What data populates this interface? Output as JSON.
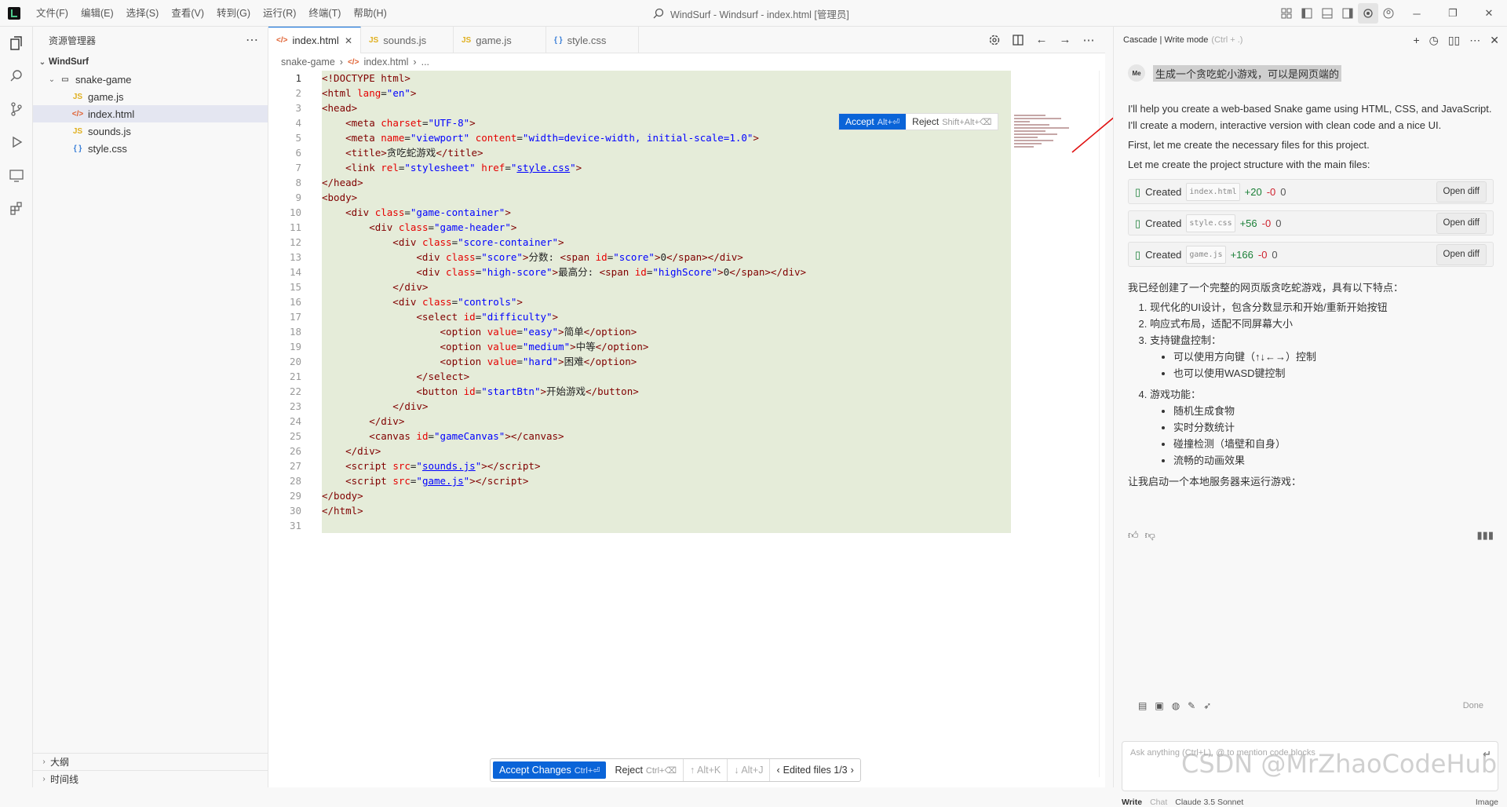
{
  "menu": [
    "文件(F)",
    "编辑(E)",
    "选择(S)",
    "查看(V)",
    "转到(G)",
    "运行(R)",
    "终端(T)",
    "帮助(H)"
  ],
  "window_title": "WindSurf - Windsurf - index.html [管理员]",
  "sidebar": {
    "title": "资源管理器",
    "root": "WindSurf",
    "folder": "snake-game",
    "files": [
      {
        "name": "game.js",
        "type": "JS",
        "color": "#e0b020"
      },
      {
        "name": "index.html",
        "type": "</>",
        "color": "#e06030"
      },
      {
        "name": "sounds.js",
        "type": "JS",
        "color": "#e0b020"
      },
      {
        "name": "style.css",
        "type": "{ }",
        "color": "#3a7fd8"
      }
    ],
    "bottom": [
      "大纲",
      "时间线"
    ]
  },
  "tabs": [
    {
      "label": "index.html",
      "type": "</>",
      "color": "#e06030"
    },
    {
      "label": "sounds.js",
      "type": "JS",
      "color": "#e0b020"
    },
    {
      "label": "game.js",
      "type": "JS",
      "color": "#e0b020"
    },
    {
      "label": "style.css",
      "type": "{ }",
      "color": "#3a7fd8"
    }
  ],
  "breadcrumb": [
    "snake-game",
    "index.html",
    "..."
  ],
  "accept_bar": {
    "accept": "Accept",
    "accept_key": "Alt+⏎",
    "reject": "Reject",
    "reject_key": "Shift+Alt+⌫"
  },
  "bottom_bar": {
    "accept_changes": "Accept Changes",
    "accept_key": "Ctrl+⏎",
    "reject": "Reject",
    "reject_key": "Ctrl+⌫",
    "prev": "↑ Alt+K",
    "next": "↓ Alt+J",
    "edited": "Edited files 1/3"
  },
  "cascade": {
    "title": "Cascade | Write mode",
    "mode_hint": "(Ctrl + .)",
    "avatar": "Me",
    "user_message": "生成一个贪吃蛇小游戏，可以是网页端的",
    "reply_paragraphs": [
      "I'll help you create a web-based Snake game using HTML, CSS, and JavaScript. I'll create a modern, interactive version with clean code and a nice UI.",
      "First, let me create the necessary files for this project.",
      "Let me create the project structure with the main files:"
    ],
    "created_files": [
      {
        "label": "Created",
        "file": "index.html",
        "plus": "+20",
        "minus": "-0",
        "zero": "0",
        "btn": "Open diff"
      },
      {
        "label": "Created",
        "file": "style.css",
        "plus": "+56",
        "minus": "-0",
        "zero": "0",
        "btn": "Open diff"
      },
      {
        "label": "Created",
        "file": "game.js",
        "plus": "+166",
        "minus": "-0",
        "zero": "0",
        "btn": "Open diff"
      }
    ],
    "summary": "我已经创建了一个完整的网页版贪吃蛇游戏，具有以下特点：",
    "features": [
      {
        "title": "现代化的UI设计，包含分数显示和开始/重新开始按钮",
        "subs": []
      },
      {
        "title": "响应式布局，适配不同屏幕大小",
        "subs": []
      },
      {
        "title": "支持键盘控制：",
        "subs": [
          "可以使用方向键（↑↓←→）控制",
          "也可以使用WASD键控制"
        ]
      },
      {
        "title": "游戏功能：",
        "subs": [
          "随机生成食物",
          "实时分数统计",
          "碰撞检测（墙壁和自身）",
          "流畅的动画效果"
        ]
      }
    ],
    "closing": "让我启动一个本地服务器来运行游戏：",
    "input_placeholder": "Ask anything (Ctrl+L), @ to mention code blocks",
    "done_label": "Done",
    "footer": {
      "write": "Write",
      "chat": "Chat",
      "model": "Claude 3.5 Sonnet",
      "image": "Image"
    }
  },
  "watermark": "CSDN @MrZhaoCodeHub"
}
